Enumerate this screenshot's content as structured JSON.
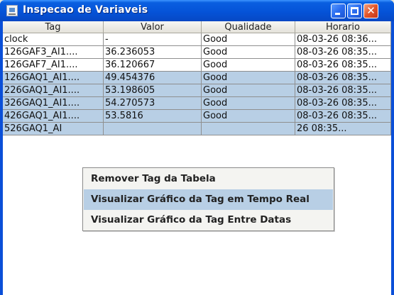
{
  "window": {
    "title": "Inspecao de Variaveis"
  },
  "table": {
    "columns": [
      "Tag",
      "Valor",
      "Qualidade",
      "Horario"
    ],
    "rows": [
      {
        "tag": "clock",
        "valor": "-",
        "qualidade": "Good",
        "horario": "08-03-26 08:36...",
        "selected": false
      },
      {
        "tag": "126GAF3_AI1....",
        "valor": "36.236053",
        "qualidade": "Good",
        "horario": "08-03-26 08:35...",
        "selected": false
      },
      {
        "tag": "126GAF7_AI1....",
        "valor": "36.120667",
        "qualidade": "Good",
        "horario": "08-03-26 08:35...",
        "selected": false
      },
      {
        "tag": "126GAQ1_AI1....",
        "valor": "49.454376",
        "qualidade": "Good",
        "horario": "08-03-26 08:35...",
        "selected": true
      },
      {
        "tag": "226GAQ1_AI1....",
        "valor": "53.198605",
        "qualidade": "Good",
        "horario": "08-03-26 08:35...",
        "selected": true
      },
      {
        "tag": "326GAQ1_AI1....",
        "valor": "54.270573",
        "qualidade": "Good",
        "horario": "08-03-26 08:35...",
        "selected": true
      },
      {
        "tag": "426GAQ1_AI1....",
        "valor": "53.5816",
        "qualidade": "Good",
        "horario": "08-03-26 08:35...",
        "selected": true
      },
      {
        "tag": "526GAQ1_AI",
        "valor": "",
        "qualidade": "",
        "horario": "26 08:35...",
        "selected": true
      }
    ]
  },
  "context_menu": {
    "items": [
      {
        "label": "Remover Tag da Tabela",
        "highlighted": false
      },
      {
        "label": "Visualizar Gráfico da Tag em Tempo Real",
        "highlighted": true
      },
      {
        "label": "Visualizar Gráfico da Tag Entre Datas",
        "highlighted": false
      }
    ]
  },
  "colors": {
    "selection": "#b8cfe5",
    "titlebar": "#0553d8"
  },
  "icons": [
    "window-app-icon",
    "minimize-icon",
    "maximize-icon",
    "close-icon"
  ]
}
